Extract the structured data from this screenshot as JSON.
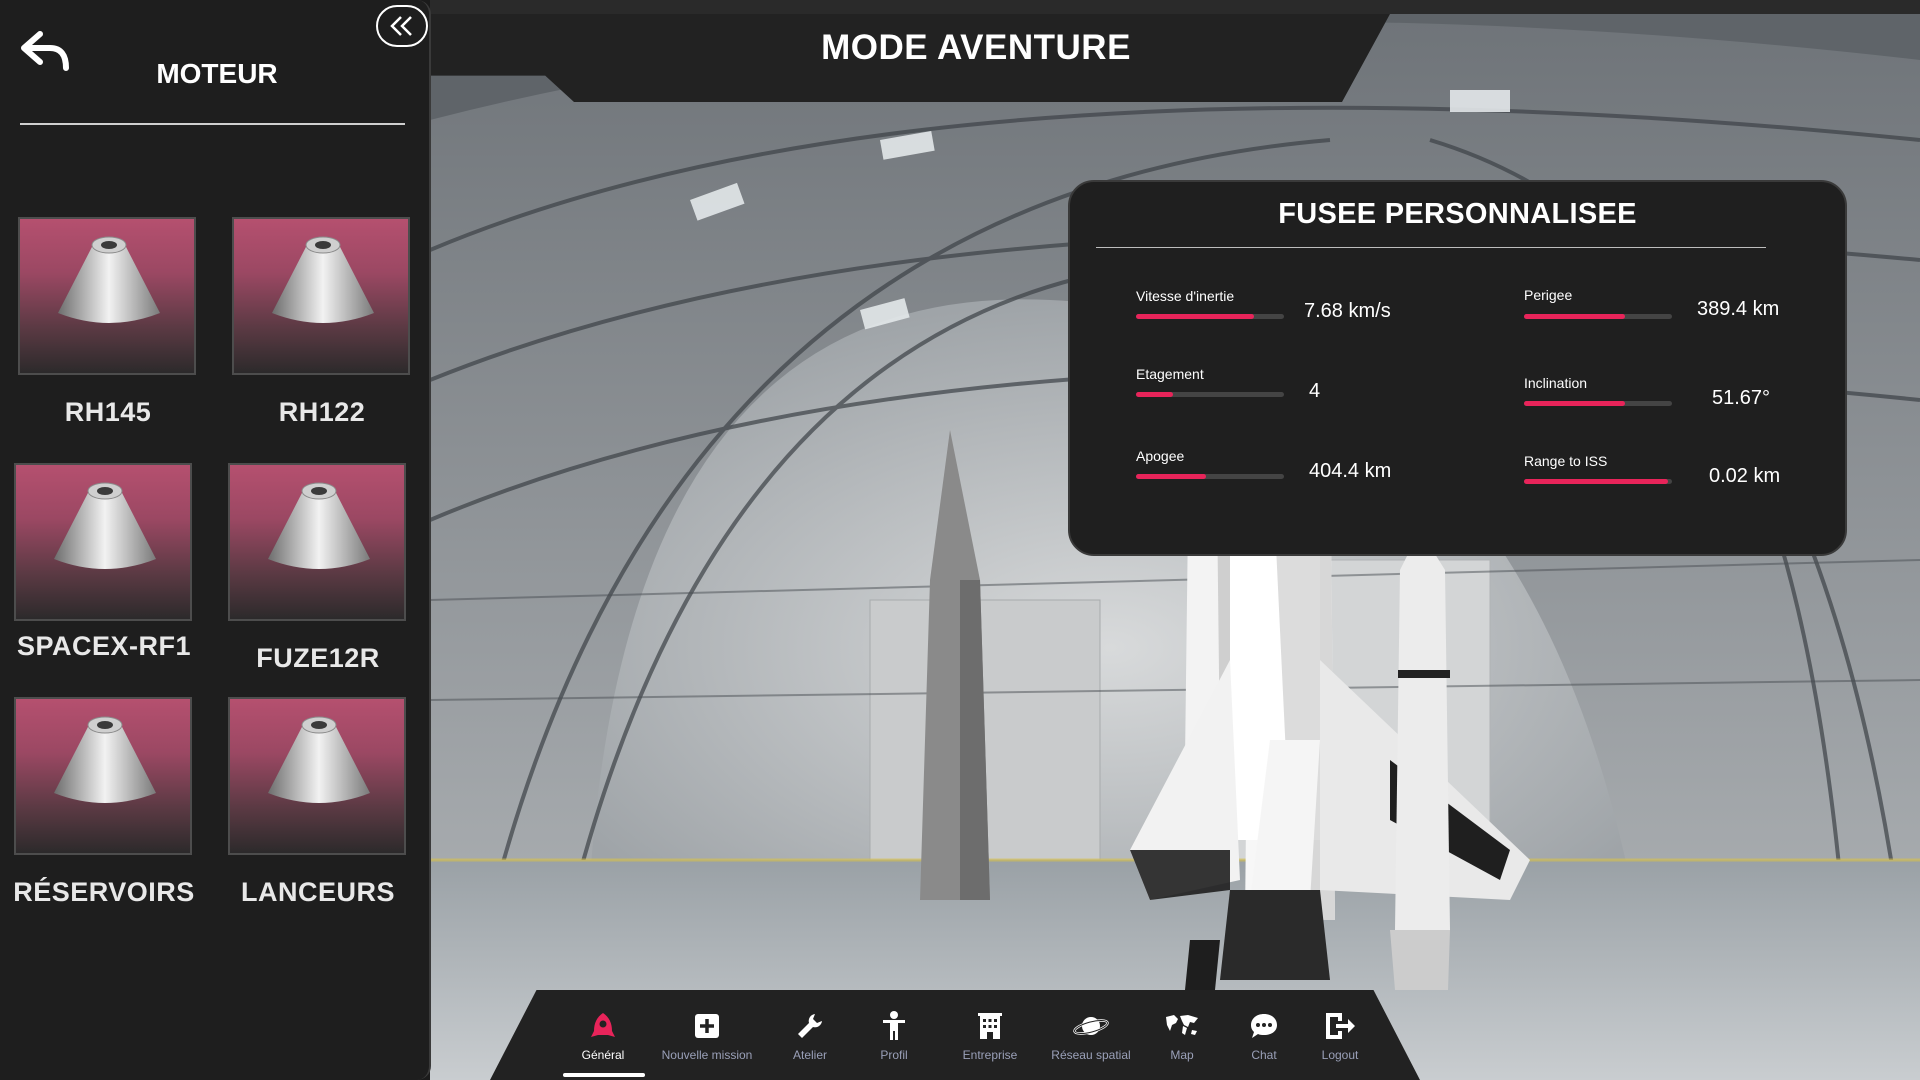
{
  "header": {
    "title": "MODE AVENTURE"
  },
  "left_panel": {
    "title": "MOTEUR",
    "engines": [
      {
        "label": "RH145"
      },
      {
        "label": "RH122"
      },
      {
        "label": "SPACEX-RF1"
      },
      {
        "label": "FUZE12R"
      },
      {
        "label": "RÉSERVOIRS"
      },
      {
        "label": "LANCEURS"
      }
    ]
  },
  "stats": {
    "title": "FUSEE PERSONNALISEE",
    "accent_color": "#e8245a",
    "items": [
      {
        "label": "Vitesse d'inertie",
        "value": "7.68 km/s",
        "level": 0.8
      },
      {
        "label": "Perigee",
        "value": "389.4 km",
        "level": 0.68
      },
      {
        "label": "Etagement",
        "value": "4",
        "level": 0.25
      },
      {
        "label": "Inclination",
        "value": "51.67°",
        "level": 0.68
      },
      {
        "label": "Apogee",
        "value": "404.4 km",
        "level": 0.47
      },
      {
        "label": "Range to ISS",
        "value": "0.02 km",
        "level": 0.97
      }
    ]
  },
  "nav": {
    "active_color": "#e8245a",
    "items": [
      {
        "label": "Général",
        "icon": "rocket-icon",
        "active": true
      },
      {
        "label": "Nouvelle mission",
        "icon": "plus-square-icon",
        "active": false
      },
      {
        "label": "Atelier",
        "icon": "wrench-icon",
        "active": false
      },
      {
        "label": "Profil",
        "icon": "person-icon",
        "active": false
      },
      {
        "label": "Entreprise",
        "icon": "building-icon",
        "active": false
      },
      {
        "label": "Réseau spatial",
        "icon": "planet-icon",
        "active": false
      },
      {
        "label": "Map",
        "icon": "world-map-icon",
        "active": false
      },
      {
        "label": "Chat",
        "icon": "chat-bubble-icon",
        "active": false
      },
      {
        "label": "Logout",
        "icon": "logout-icon",
        "active": false
      }
    ]
  }
}
